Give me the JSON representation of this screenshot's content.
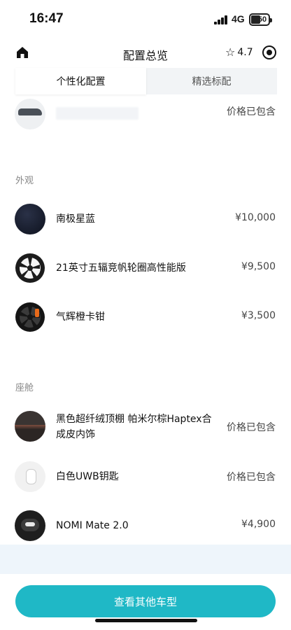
{
  "status_bar": {
    "time": "16:47",
    "network": "4G",
    "battery": "50"
  },
  "navbar": {
    "title": "配置总览",
    "rating": "4.7",
    "home_icon": "home-icon",
    "target_icon": "target-icon"
  },
  "tabs": [
    {
      "label": "个性化配置",
      "active": true
    },
    {
      "label": "精选标配",
      "active": false
    }
  ],
  "top_item": {
    "price": "价格已包含"
  },
  "sections": {
    "exterior": {
      "title": "外观",
      "items": [
        {
          "label": "南极星蓝",
          "price": "¥10,000"
        },
        {
          "label": "21英寸五辐竞帆轮圈高性能版",
          "price": "¥9,500"
        },
        {
          "label": "气辉橙卡钳",
          "price": "¥3,500"
        }
      ]
    },
    "cabin": {
      "title": "座舱",
      "items": [
        {
          "label": "黑色超纤绒顶棚 帕米尔棕Haptex合成皮内饰",
          "price": "价格已包含"
        },
        {
          "label": "白色UWB钥匙",
          "price": "价格已包含"
        },
        {
          "label": "NOMI Mate 2.0",
          "price": "¥4,900"
        }
      ]
    }
  },
  "cta": {
    "label": "查看其他车型"
  },
  "colors": {
    "accent": "#1fb8c6",
    "caliper": "#e86a1a"
  }
}
